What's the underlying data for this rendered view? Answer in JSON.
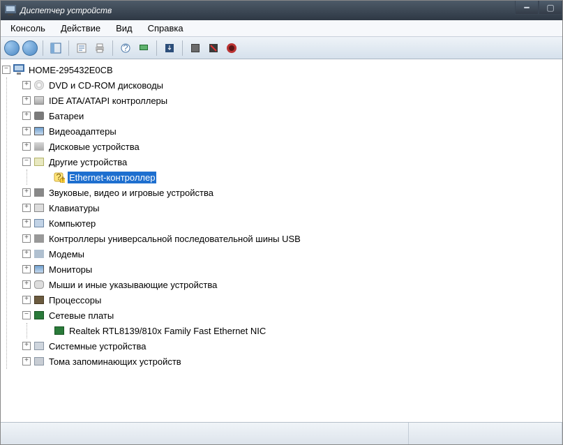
{
  "window": {
    "title": "Диспетчер устройств"
  },
  "menu": {
    "items": [
      "Консоль",
      "Действие",
      "Вид",
      "Справка"
    ]
  },
  "tree": {
    "root": {
      "label": "HOME-295432E0CB",
      "expanded": true,
      "icon": "computer",
      "children": [
        {
          "label": "DVD и CD-ROM дисководы",
          "icon": "disc",
          "expanded": false,
          "children": []
        },
        {
          "label": "IDE ATA/ATAPI контроллеры",
          "icon": "drive",
          "expanded": false,
          "children": []
        },
        {
          "label": "Батареи",
          "icon": "battery",
          "expanded": false,
          "children": []
        },
        {
          "label": "Видеоадаптеры",
          "icon": "monitor",
          "expanded": false,
          "children": []
        },
        {
          "label": "Дисковые устройства",
          "icon": "hdd",
          "expanded": false,
          "children": []
        },
        {
          "label": "Другие устройства",
          "icon": "other",
          "expanded": true,
          "children": [
            {
              "label": "Ethernet-контроллер",
              "icon": "unknown-warn",
              "selected": true
            }
          ]
        },
        {
          "label": "Звуковые, видео и игровые устройства",
          "icon": "sound",
          "expanded": false,
          "children": []
        },
        {
          "label": "Клавиатуры",
          "icon": "keyboard",
          "expanded": false,
          "children": []
        },
        {
          "label": "Компьютер",
          "icon": "comp",
          "expanded": false,
          "children": []
        },
        {
          "label": "Контроллеры универсальной последовательной шины USB",
          "icon": "usb",
          "expanded": false,
          "children": []
        },
        {
          "label": "Модемы",
          "icon": "modem",
          "expanded": false,
          "children": []
        },
        {
          "label": "Мониторы",
          "icon": "monitor",
          "expanded": false,
          "children": []
        },
        {
          "label": "Мыши и иные указывающие устройства",
          "icon": "mouse",
          "expanded": false,
          "children": []
        },
        {
          "label": "Процессоры",
          "icon": "cpu",
          "expanded": false,
          "children": []
        },
        {
          "label": "Сетевые платы",
          "icon": "net",
          "expanded": true,
          "children": [
            {
              "label": "Realtek RTL8139/810x Family Fast Ethernet NIC",
              "icon": "net"
            }
          ]
        },
        {
          "label": "Системные устройства",
          "icon": "sys",
          "expanded": false,
          "children": []
        },
        {
          "label": "Тома запоминающих устройств",
          "icon": "vol",
          "expanded": false,
          "children": []
        }
      ]
    }
  }
}
